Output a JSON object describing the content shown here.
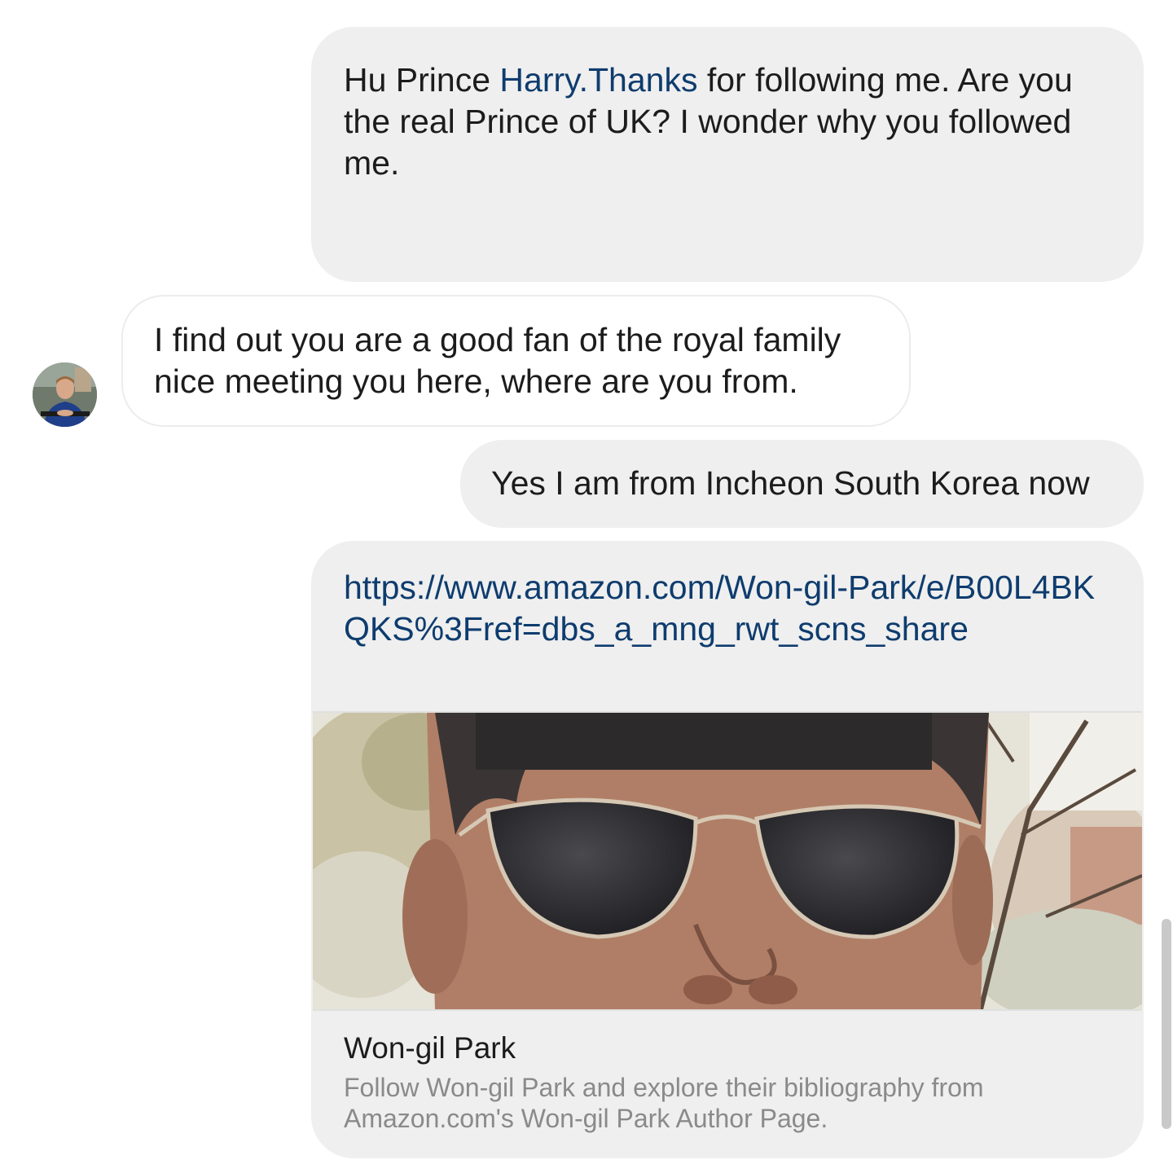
{
  "messages": [
    {
      "direction": "sent",
      "text_before": "Hu Prince ",
      "link": "Harry.Thanks",
      "text_after": " for following me. Are you the real Prince of UK? I wonder why you followed me."
    },
    {
      "direction": "received",
      "avatar_icon": "avatar-man-in-blue-shirt",
      "text": "I find out you are a good fan of the royal family nice meeting you here, where are you from."
    },
    {
      "direction": "sent",
      "text": "Yes I am from Incheon South Korea now"
    }
  ],
  "link_card": {
    "url": "https://www.amazon.com/Won-gil-Park/e/B00L4BKQKS%3Fref=dbs_a_mng_rwt_scns_share",
    "image_description_icon": "author-photo-man-in-sunglasses",
    "title": "Won-gil Park",
    "description": "Follow Won-gil Park and explore their bibliography from Amazon.com's Won-gil Park Author Page."
  },
  "colors": {
    "sent_bubble": "#efefef",
    "link": "#0e3c6e",
    "text": "#1c1c1c",
    "secondary_text": "#8a8a8a"
  }
}
